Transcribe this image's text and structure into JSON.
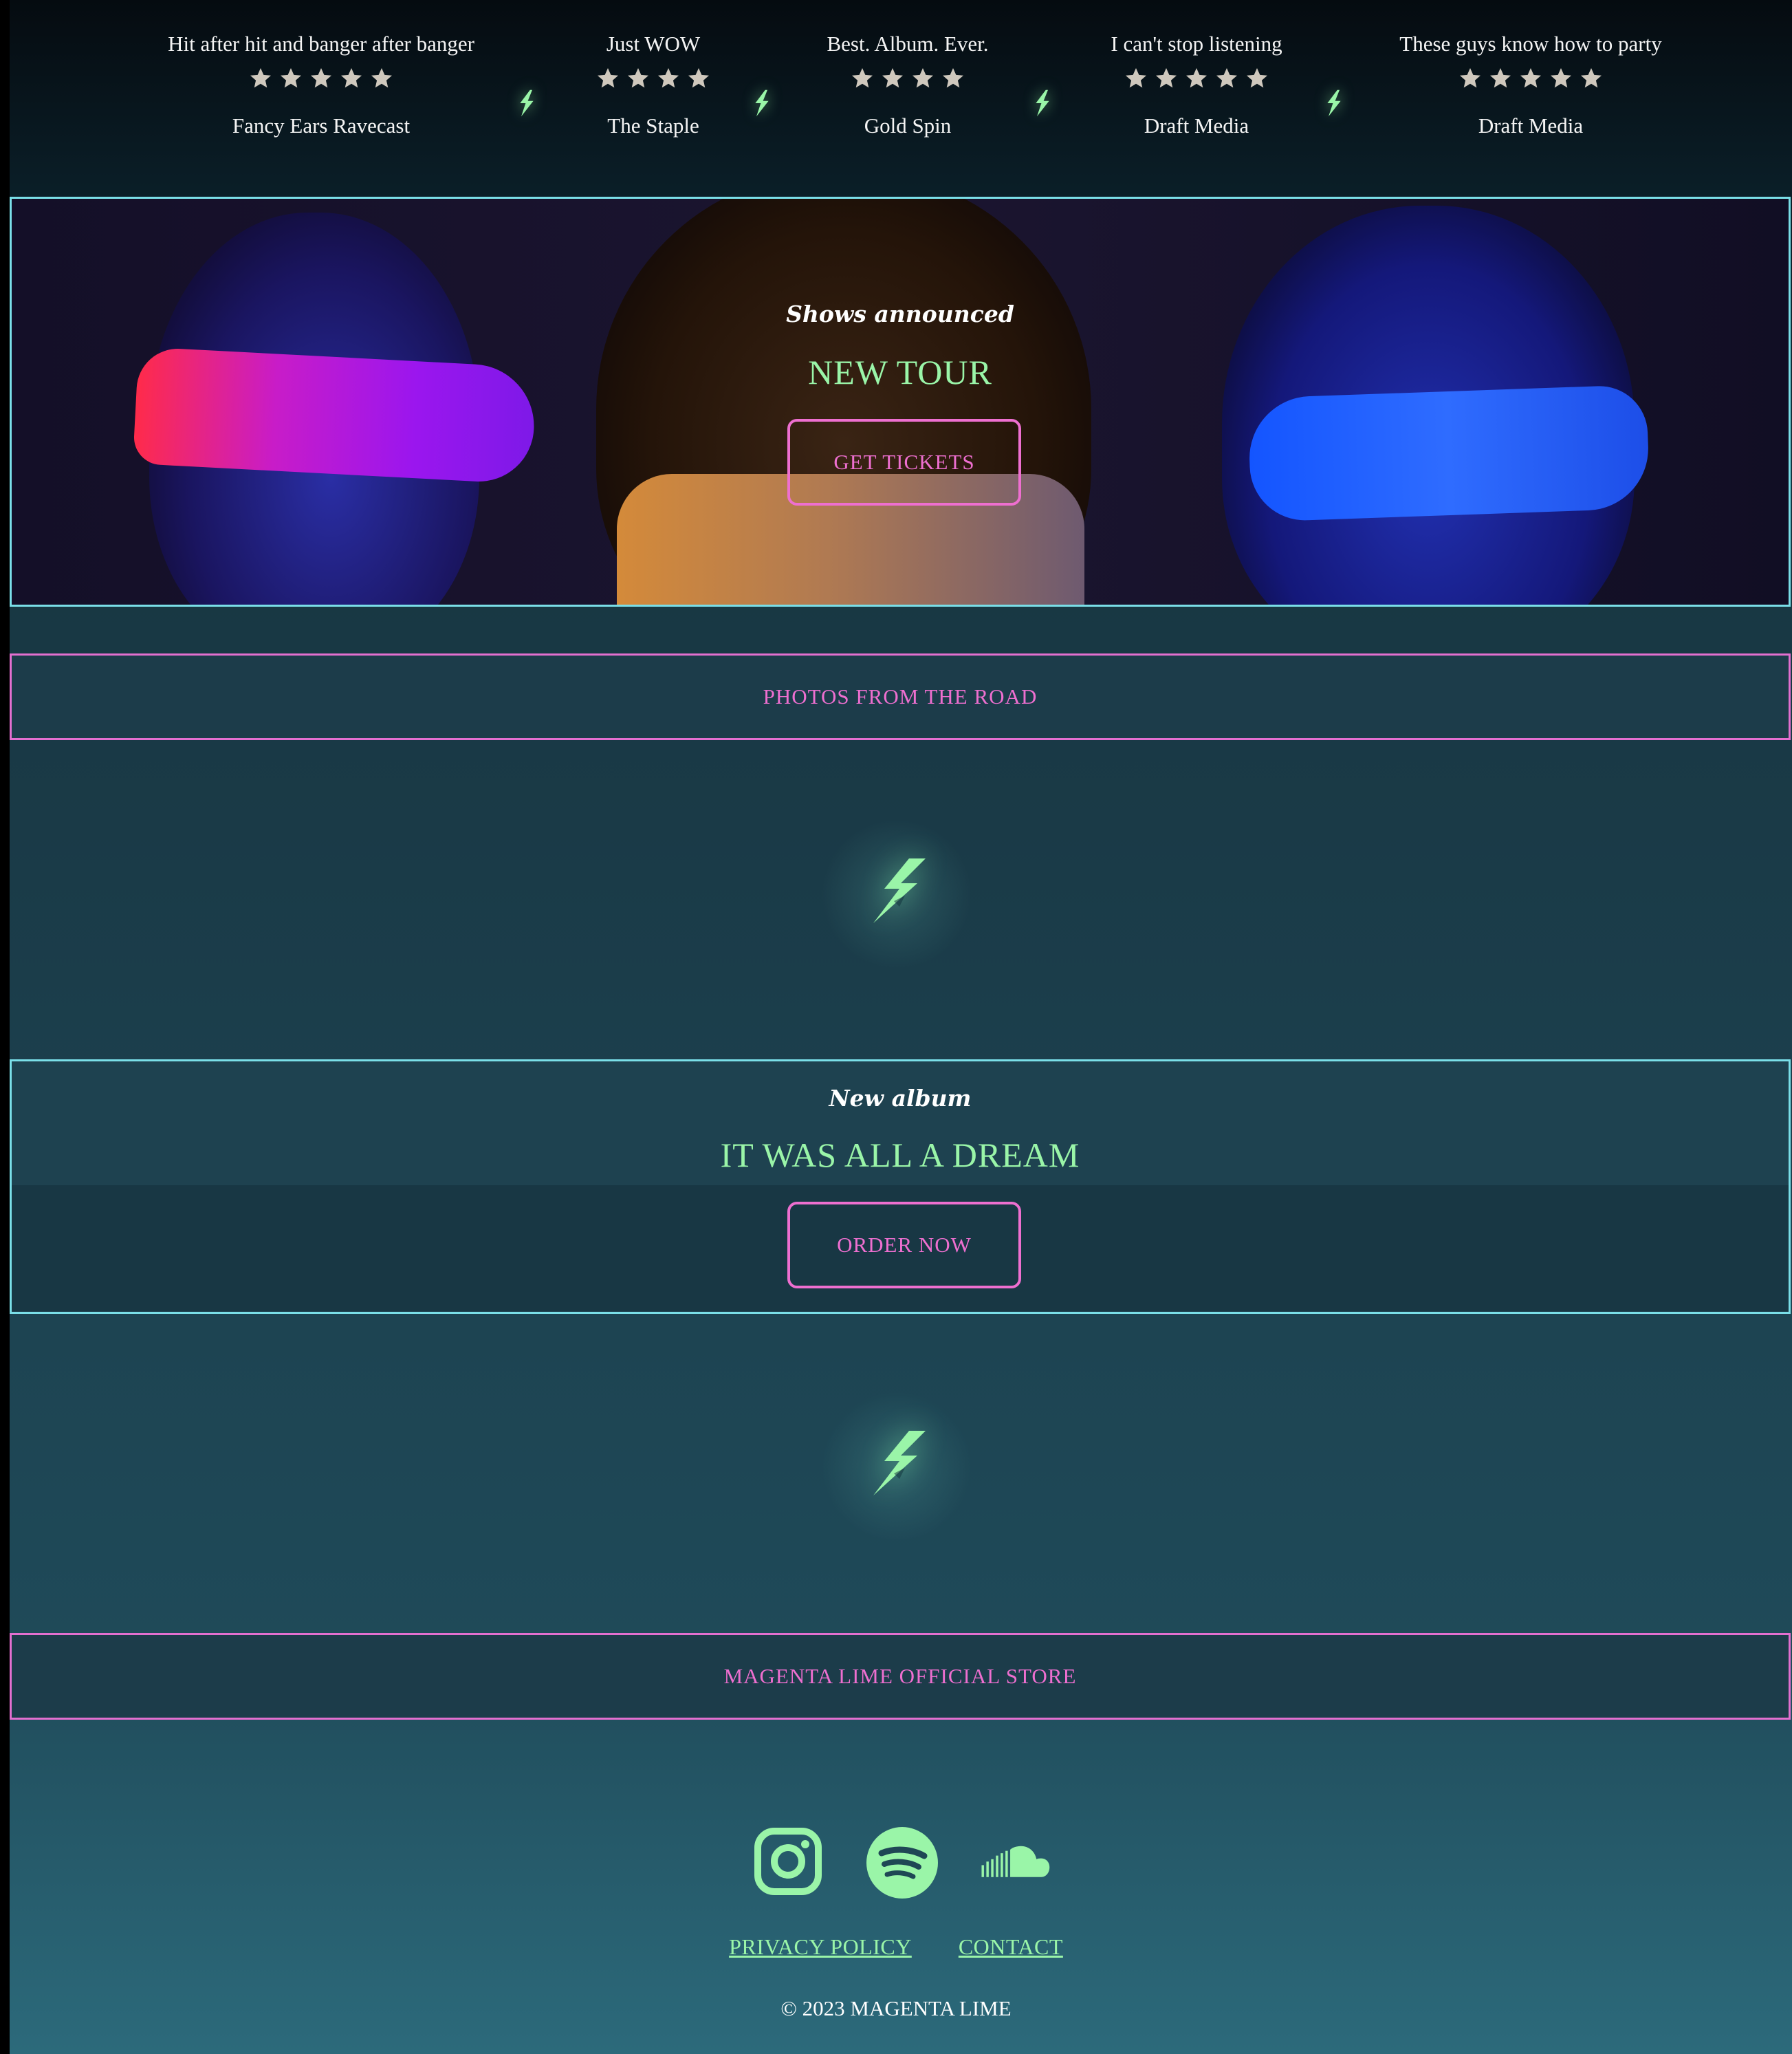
{
  "reviews": [
    {
      "quote": "Hit after hit and banger after banger",
      "stars": 5,
      "source": "Fancy Ears Ravecast"
    },
    {
      "quote": "Just WOW",
      "stars": 4,
      "source": "The Staple"
    },
    {
      "quote": "Best. Album. Ever.",
      "stars": 4,
      "source": "Gold Spin"
    },
    {
      "quote": "I can't stop listening",
      "stars": 5,
      "source": "Draft Media"
    },
    {
      "quote": "These guys know how to party",
      "stars": 5,
      "source": "Draft Media"
    }
  ],
  "hero": {
    "subtitle": "Shows announced",
    "title": "NEW TOUR",
    "button": "GET TICKETS"
  },
  "photos_banner": "PHOTOS FROM THE ROAD",
  "album": {
    "subtitle": "New album",
    "title": "IT WAS ALL A DREAM",
    "button": "ORDER NOW"
  },
  "store_banner": "MAGENTA LIME OFFICIAL STORE",
  "footer": {
    "social": [
      "instagram-icon",
      "spotify-icon",
      "soundcloud-icon"
    ],
    "links": {
      "privacy": "PRIVACY POLICY",
      "contact": "CONTACT"
    },
    "copyright": "© 2023 MAGENTA LIME"
  },
  "colors": {
    "accent_lime": "#9af5a8",
    "accent_magenta": "#ee6fd0",
    "accent_cyan": "#7adfe8",
    "star": "#cfc8bd"
  }
}
